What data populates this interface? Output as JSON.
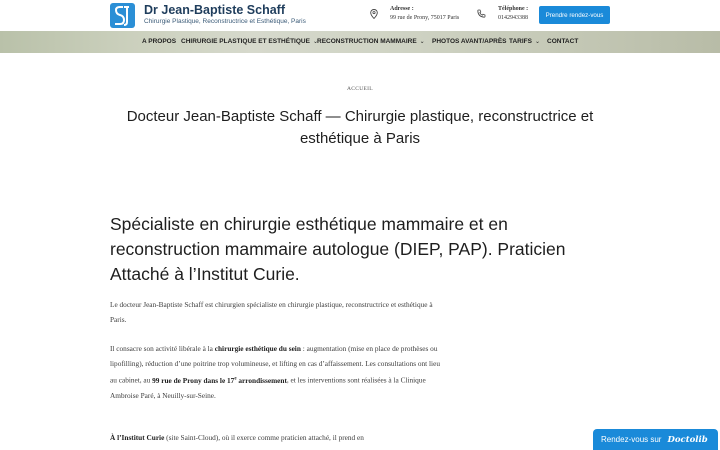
{
  "header": {
    "brand_name": "Dr Jean-Baptiste Schaff",
    "brand_tagline": "Chirurgie Plastique, Reconstructrice et Esthétique, Paris",
    "address_label": "Adresse :",
    "address_value": "99 rue de Prony, 75017 Paris",
    "phone_label": "Téléphone :",
    "phone_value": "0142943388",
    "cta_label": "Prendre rendez-vous",
    "accent_color": "#1a8ad9"
  },
  "nav": {
    "items": [
      {
        "label": "A PROPOS",
        "has_dropdown": false
      },
      {
        "label": "CHIRURGIE PLASTIQUE ET ESTHÉTIQUE",
        "has_dropdown": true
      },
      {
        "label": "RECONSTRUCTION MAMMAIRE",
        "has_dropdown": true
      },
      {
        "label": "PHOTOS AVANT/APRÈS",
        "has_dropdown": false
      },
      {
        "label": "TARIFS",
        "has_dropdown": true
      },
      {
        "label": "CONTACT",
        "has_dropdown": false
      }
    ]
  },
  "breadcrumb": "ACCUEIL",
  "page_title": "Docteur Jean-Baptiste Schaff — Chirurgie plastique, reconstructrice et esthétique à Paris",
  "headline": "Spécialiste en chirurgie esthétique mammaire et en reconstruction mammaire autologue (DIEP, PAP). Praticien Attaché à l’Institut Curie.",
  "body": {
    "p1": "Le docteur Jean-Baptiste Schaff est chirurgien spécialiste en chirurgie plastique, reconstructrice et esthétique à Paris.",
    "p2_a": "Il consacre son activité libérale à la ",
    "p2_b": "chirurgie esthétique du sein",
    "p2_c": " : augmentation (mise en place de prothèses ou lipofilling), réduction d’une poitrine trop volumineuse, et lifting en cas d’affaissement. Les consultations ont lieu au cabinet, au ",
    "p2_d": "99 rue de Prony dans le 17",
    "p2_sup": "e",
    "p2_e": " arrondissement",
    "p2_f": ", et les interventions sont réalisées à la Clinique Ambroise Paré, à Neuilly-sur-Seine.",
    "p3_a": "À l’Institut Curie",
    "p3_b": " (site Saint-Cloud), où il exerce comme praticien attaché, il prend en"
  },
  "widget": {
    "label": "Rendez-vous sur",
    "brand": "Doctolib"
  },
  "icons": [
    "logo-icon",
    "location-pin-icon",
    "phone-icon",
    "chevron-down-icon"
  ]
}
